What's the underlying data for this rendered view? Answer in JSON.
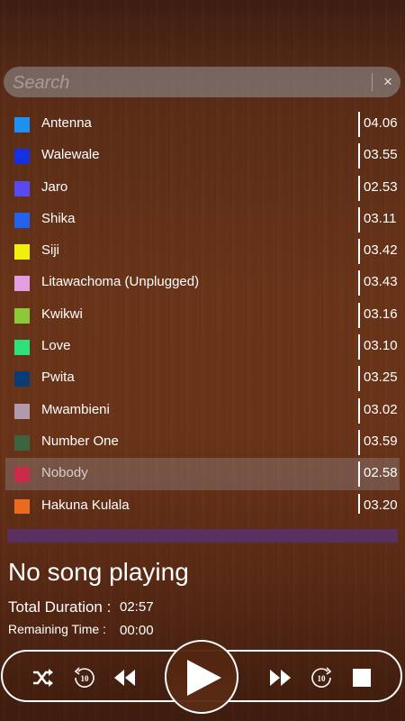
{
  "search": {
    "placeholder": "Search",
    "clear_label": "×"
  },
  "songs": [
    {
      "title": "Antenna",
      "duration": "04.06",
      "color": "#1e90f0"
    },
    {
      "title": "Walewale",
      "duration": "03.55",
      "color": "#1530e0"
    },
    {
      "title": "Jaro",
      "duration": "02.53",
      "color": "#5a48f0"
    },
    {
      "title": "Shika",
      "duration": "03.11",
      "color": "#2262ec"
    },
    {
      "title": "Siji",
      "duration": "03.42",
      "color": "#eef010"
    },
    {
      "title": "Litawachoma (Unplugged)",
      "duration": "03.43",
      "color": "#e49ee0"
    },
    {
      "title": "Kwikwi",
      "duration": "03.16",
      "color": "#8cc838"
    },
    {
      "title": "Love",
      "duration": "03.10",
      "color": "#2ce07a"
    },
    {
      "title": "Pwita",
      "duration": "03.25",
      "color": "#0c3a72"
    },
    {
      "title": "Mwambieni",
      "duration": "03.02",
      "color": "#b09aac"
    },
    {
      "title": "Number One",
      "duration": "03.59",
      "color": "#3c6440"
    },
    {
      "title": "Nobody",
      "duration": "02.58",
      "color": "#cc2a48",
      "selected": true
    },
    {
      "title": "Hakuna Kulala",
      "duration": "03.20",
      "color": "#ea6a1e"
    }
  ],
  "progress": {
    "fraction": 0.0,
    "track_color": "#5a3061"
  },
  "now_playing": {
    "title": "No song playing",
    "total_label": "Total Duration :",
    "total_value": "02:57",
    "remaining_label": "Remaining Time :",
    "remaining_value": "00:00"
  },
  "controls": {
    "shuffle_icon": "shuffle-icon",
    "rewind10_icon": "replay-10-icon",
    "rewind_icon": "rewind-icon",
    "play_icon": "play-icon",
    "fastforward_icon": "fast-forward-icon",
    "forward10_icon": "forward-10-icon",
    "stop_icon": "stop-icon",
    "replay_number": "10",
    "forward_number": "10"
  }
}
